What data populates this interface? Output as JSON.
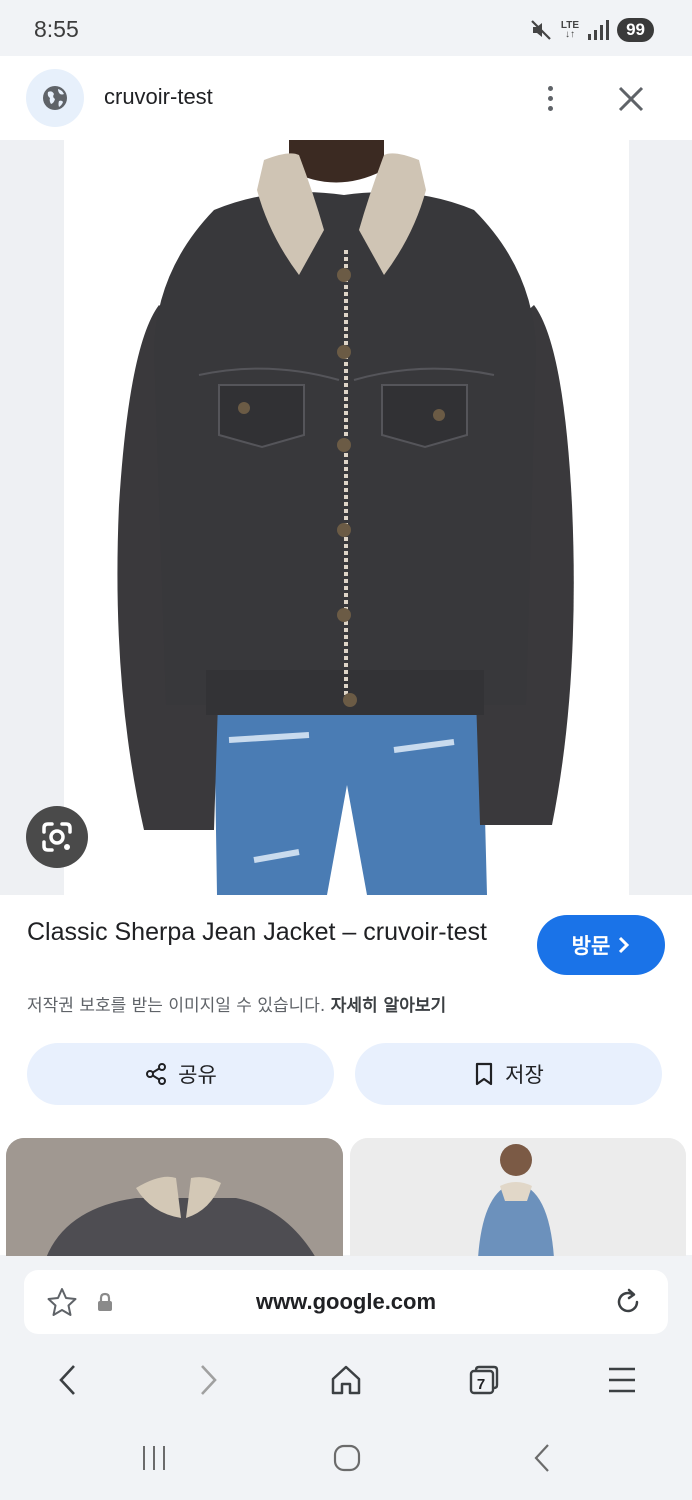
{
  "status_bar": {
    "time": "8:55",
    "network": "LTE",
    "battery": "99"
  },
  "header": {
    "site_name": "cruvoir-test"
  },
  "result": {
    "title": "Classic Sherpa Jean Jacket – cruvoir-test",
    "visit_label": "방문",
    "copyright_text": "저작권 보호를 받는 이미지일 수 있습니다.",
    "learn_more": "자세히 알아보기",
    "share_label": "공유",
    "save_label": "저장"
  },
  "browser": {
    "url": "www.google.com",
    "tab_count": "7"
  },
  "icons": [
    "globe-icon",
    "more-vert-icon",
    "close-icon",
    "google-lens-icon",
    "chevron-right-icon",
    "share-icon",
    "bookmark-icon",
    "star-icon",
    "lock-icon",
    "reload-icon",
    "back-icon",
    "forward-icon",
    "home-icon",
    "tabs-icon",
    "menu-icon"
  ],
  "colors": {
    "accent": "#1a73e8",
    "button_bg": "#e8f0fd",
    "page_bg": "#f1f3f6"
  }
}
